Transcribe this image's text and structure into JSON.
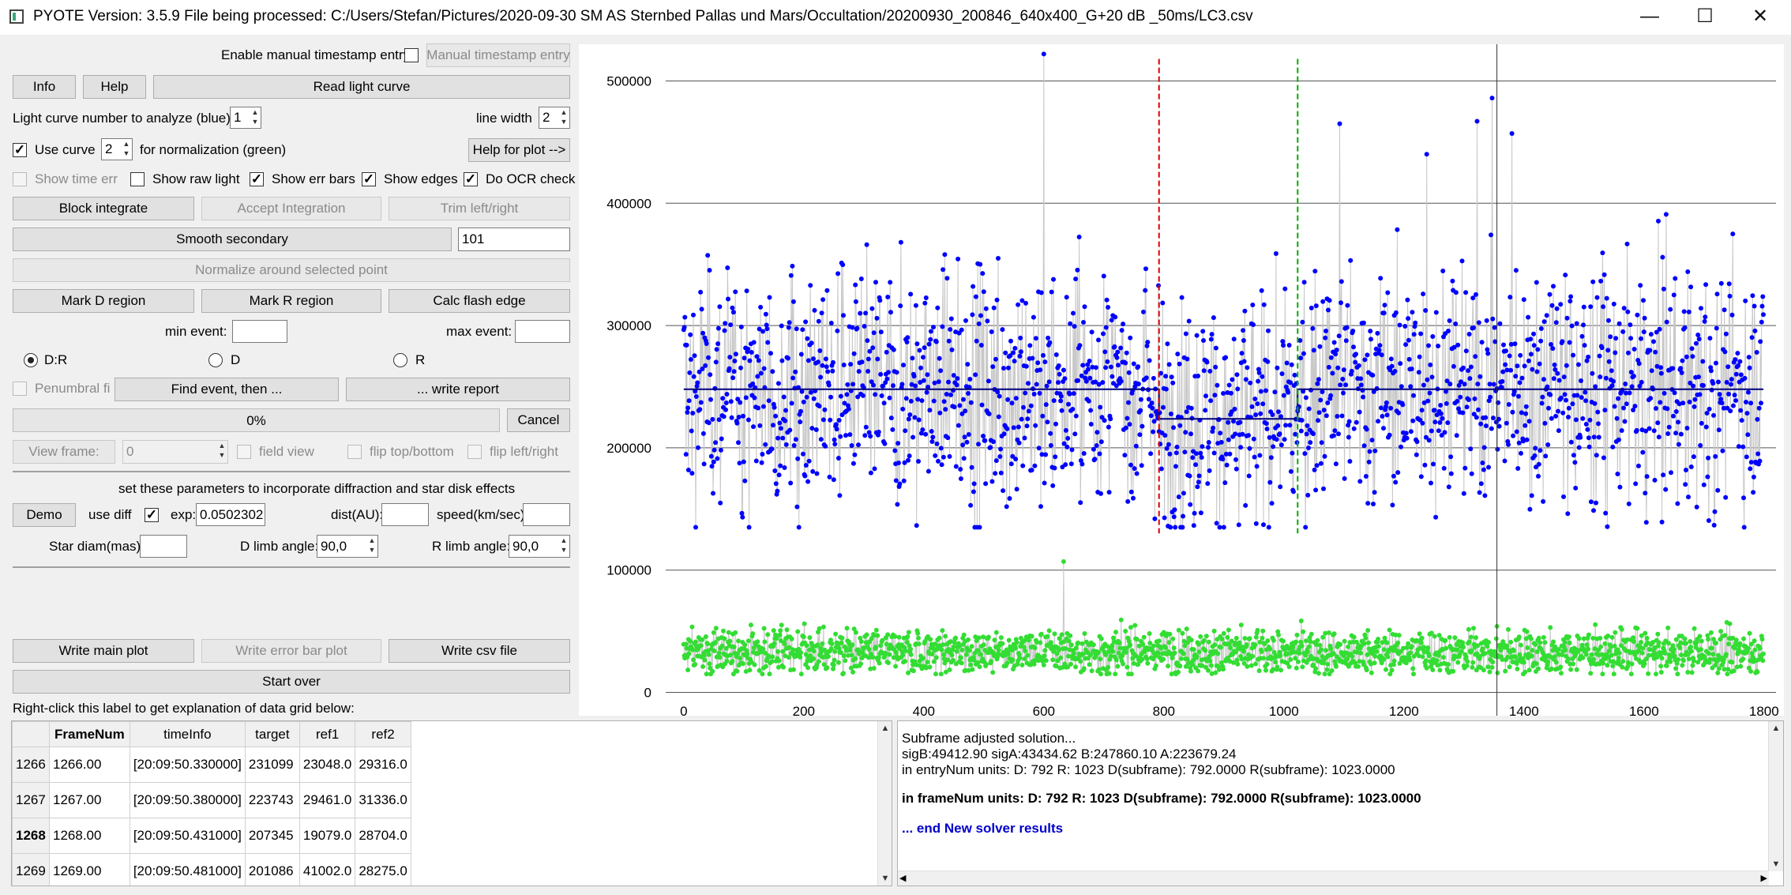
{
  "window": {
    "title": "PYOTE Version: 3.5.9  File being processed: C:/Users/Stefan/Pictures/2020-09-30 SM AS Sternbed Pallas und Mars/Occultation/20200930_200846_640x400_G+20 dB  _50ms/LC3.csv",
    "minimize": "—",
    "maximize": "☐",
    "close": "✕"
  },
  "controls": {
    "manual_ts_label": "Enable manual timestamp entry",
    "manual_ts_button": "Manual timestamp entry",
    "info": "Info",
    "help": "Help",
    "read_light_curve": "Read light curve",
    "lc_number_label": "Light curve number to analyze (blue):",
    "lc_number_value": "1",
    "line_width_label": "line width",
    "line_width_value": "2",
    "use_curve_label": "Use curve",
    "use_curve_value": "2",
    "normalization_label": "for normalization (green)",
    "help_for_plot": "Help for plot -->",
    "show_time_err": "Show time err",
    "show_raw_light": "Show raw light",
    "show_err_bars": "Show err bars",
    "show_edges": "Show edges",
    "do_ocr_check": "Do OCR check",
    "block_integrate": "Block integrate",
    "accept_integration": "Accept Integration",
    "trim_left_right": "Trim left/right",
    "smooth_secondary": "Smooth secondary",
    "smooth_value": "101",
    "normalize_around": "Normalize around selected point",
    "mark_d_region": "Mark D region",
    "mark_r_region": "Mark R region",
    "calc_flash_edge": "Calc flash edge",
    "min_event_label": "min event:",
    "max_event_label": "max event:",
    "radio_dr": "D:R",
    "radio_d": "D",
    "radio_r": "R",
    "penumbral_fit": "Penumbral fi",
    "find_event": "Find event, then ...",
    "write_report": "... write report",
    "progress_text": "0%",
    "progress_value": 0,
    "cancel": "Cancel",
    "view_frame": "View frame:",
    "view_frame_value": "0",
    "field_view": "field view",
    "flip_top_bottom": "flip top/bottom",
    "flip_left_right": "flip left/right",
    "diffraction_note": "set these parameters to incorporate diffraction and star disk effects",
    "demo": "Demo",
    "use_diff": "use diff",
    "exp_label": "exp:",
    "exp_value": "0.0502302",
    "dist_label": "dist(AU):",
    "speed_label": "speed(km/sec):",
    "star_diam_label": "Star diam(mas):",
    "d_limb_label": "D limb angle:",
    "d_limb_value": "90,0",
    "r_limb_label": "R limb angle:",
    "r_limb_value": "90,0",
    "write_main_plot": "Write main plot",
    "write_error_bar_plot": "Write error bar plot",
    "write_csv_file": "Write csv file",
    "start_over": "Start over",
    "grid_hint": "Right-click this label to get explanation of data grid below:"
  },
  "table": {
    "columns": [
      "FrameNum",
      "timeInfo",
      "target",
      "ref1",
      "ref2"
    ],
    "rows": [
      {
        "row": "1266",
        "cells": [
          "1266.00",
          "[20:09:50.330000]",
          "231099",
          "23048.0",
          "29316.0"
        ]
      },
      {
        "row": "1267",
        "cells": [
          "1267.00",
          "[20:09:50.380000]",
          "223743",
          "29461.0",
          "31336.0"
        ]
      },
      {
        "row": "1268",
        "cells": [
          "1268.00",
          "[20:09:50.431000]",
          "207345",
          "19079.0",
          "28704.0"
        ]
      },
      {
        "row": "1269",
        "cells": [
          "1269.00",
          "[20:09:50.481000]",
          "201086",
          "41002.0",
          "28275.0"
        ]
      }
    ]
  },
  "output": {
    "line1": "Subframe adjusted solution...",
    "line2": "sigB:49412.90 sigA:43434.62 B:247860.10 A:223679.24",
    "line3": "in entryNum units: D: 792 R: 1023 D(subframe): 792.0000 R(subframe): 1023.0000",
    "line4": "in frameNum units: D: 792 R: 1023 D(subframe): 792.0000 R(subframe): 1023.0000",
    "line5": "... end New solver results",
    "accent_color": "#0000cc"
  },
  "chart_data": {
    "type": "scatter",
    "title": "",
    "xlabel": "",
    "ylabel": "",
    "xlim": [
      -30,
      1820
    ],
    "ylim": [
      -10000,
      530000
    ],
    "xticks": [
      0,
      200,
      400,
      600,
      800,
      1000,
      1200,
      1400,
      1600,
      1800
    ],
    "yticks": [
      0,
      100000,
      200000,
      300000,
      400000,
      500000
    ],
    "grid_y": true,
    "n_points": 1800,
    "series": [
      {
        "role": "target light curve",
        "color": "#0000ff",
        "baseline_level": 247860,
        "event_level": 223679,
        "typical_range": [
          150000,
          400000
        ],
        "notable_points": [
          {
            "x": 600,
            "y": 522000
          },
          {
            "x": 1093,
            "y": 465000
          },
          {
            "x": 1347,
            "y": 486000
          },
          {
            "x": 1380,
            "y": 457000
          },
          {
            "x": 1322,
            "y": 467000
          },
          {
            "x": 1238,
            "y": 440000
          },
          {
            "x": 925,
            "y": 137000
          }
        ]
      },
      {
        "role": "normalization reference curve",
        "color": "#33dd33",
        "typical_range": [
          15000,
          65000
        ],
        "notable_points": [
          {
            "x": 633,
            "y": 107000
          }
        ]
      }
    ],
    "fit_line": {
      "color": "#000080",
      "baseline": 247860,
      "event": 223679,
      "d": 792,
      "r": 1023
    },
    "d_edge": {
      "x": 792,
      "color": "#dd0000",
      "ymin": 130000,
      "ymax": 518000
    },
    "r_edge": {
      "x": 1023,
      "color": "#00aa00",
      "ymin": 130000,
      "ymax": 518000
    },
    "cursor_x": 1355
  }
}
